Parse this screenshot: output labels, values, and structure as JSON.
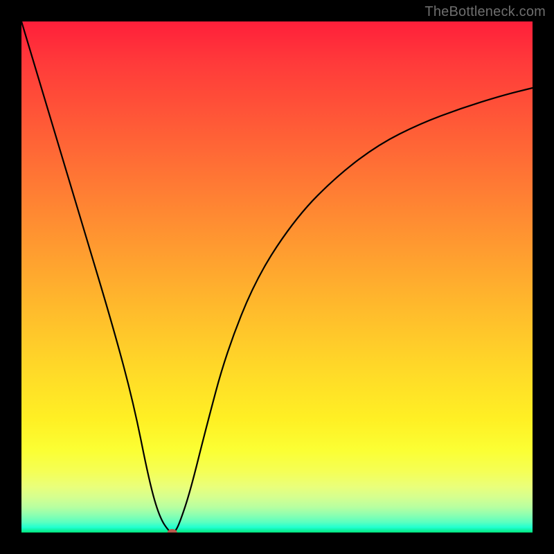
{
  "watermark": "TheBottleneck.com",
  "chart_data": {
    "type": "line",
    "title": "",
    "xlabel": "",
    "ylabel": "",
    "xlim": [
      0,
      100
    ],
    "ylim": [
      0,
      100
    ],
    "grid": false,
    "legend": false,
    "series": [
      {
        "name": "bottleneck-curve",
        "x": [
          0,
          6,
          12,
          18,
          22,
          25,
          27,
          29,
          30,
          31,
          33,
          36,
          40,
          46,
          54,
          62,
          70,
          78,
          86,
          94,
          100
        ],
        "values": [
          100,
          80,
          60,
          40,
          25,
          10,
          3,
          0,
          0,
          2,
          8,
          20,
          35,
          50,
          62,
          70,
          76,
          80,
          83,
          85.5,
          87
        ]
      }
    ],
    "marker": {
      "name": "optimal-point",
      "x": 29.5,
      "y": 0,
      "color": "#b85a4c",
      "rx": 7,
      "ry": 5
    },
    "background_gradient": {
      "top": "#ff1f3a",
      "mid_upper": "#ff9a30",
      "mid": "#fff024",
      "lower": "#eaff7a",
      "bottom": "#02e57b"
    }
  }
}
